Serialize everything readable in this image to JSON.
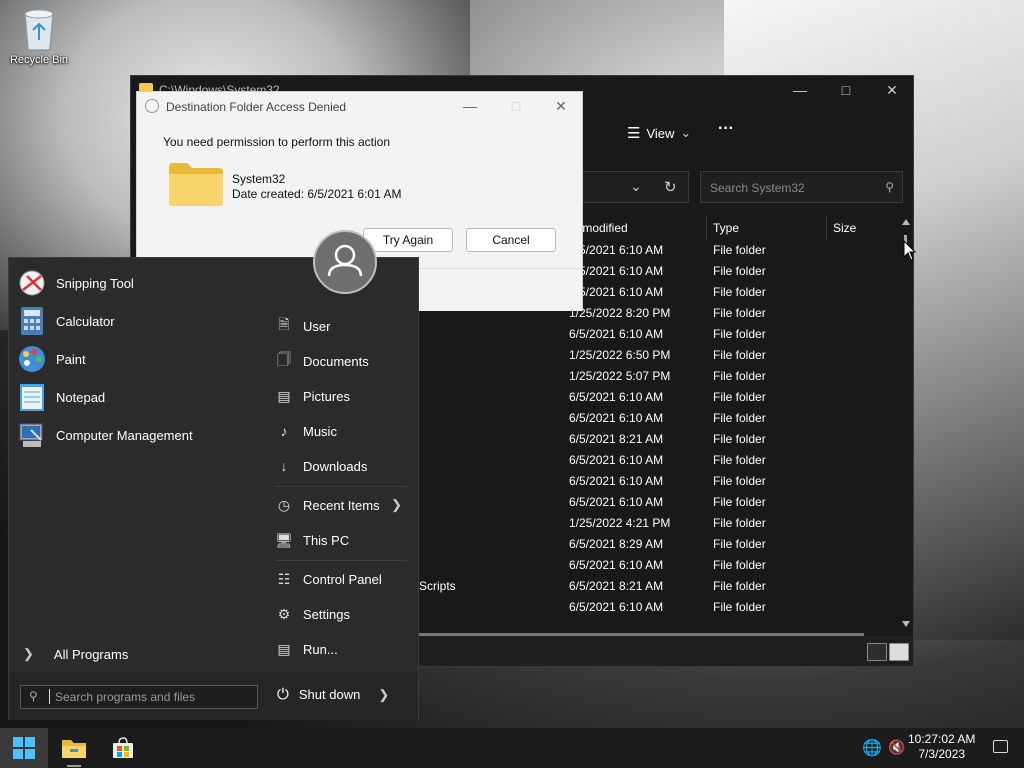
{
  "desktop": {
    "recycle_bin_label": "Recycle Bin"
  },
  "explorer": {
    "title_path": "C:\\Windows\\System32",
    "toolbar": {
      "view_label": "View",
      "more_label": "···"
    },
    "search_placeholder": "Search System32",
    "columns": {
      "modified": "te modified",
      "type": "Type",
      "size": "Size"
    },
    "rows": [
      {
        "name": "",
        "modified": "6/5/2021 6:10 AM",
        "type": "File folder"
      },
      {
        "name": "",
        "modified": "6/5/2021 6:10 AM",
        "type": "File folder"
      },
      {
        "name": "",
        "modified": "6/5/2021 6:10 AM",
        "type": "File folder"
      },
      {
        "name": "",
        "modified": "1/25/2022 8:20 PM",
        "type": "File folder"
      },
      {
        "name": "",
        "modified": "6/5/2021 6:10 AM",
        "type": "File folder"
      },
      {
        "name": "",
        "modified": "1/25/2022 6:50 PM",
        "type": "File folder"
      },
      {
        "name": "",
        "modified": "1/25/2022 5:07 PM",
        "type": "File folder"
      },
      {
        "name": "",
        "modified": "6/5/2021 6:10 AM",
        "type": "File folder"
      },
      {
        "name": "",
        "modified": "6/5/2021 6:10 AM",
        "type": "File folder"
      },
      {
        "name": "",
        "modified": "6/5/2021 8:21 AM",
        "type": "File folder"
      },
      {
        "name": "",
        "modified": "6/5/2021 6:10 AM",
        "type": "File folder"
      },
      {
        "name": "",
        "modified": "6/5/2021 6:10 AM",
        "type": "File folder"
      },
      {
        "name": "",
        "modified": "6/5/2021 6:10 AM",
        "type": "File folder"
      },
      {
        "name": "",
        "modified": "1/25/2022 4:21 PM",
        "type": "File folder"
      },
      {
        "name": "",
        "modified": "6/5/2021 8:29 AM",
        "type": "File folder"
      },
      {
        "name": "",
        "modified": "6/5/2021 6:10 AM",
        "type": "File folder"
      },
      {
        "name": "Scripts",
        "modified": "6/5/2021 8:21 AM",
        "type": "File folder"
      },
      {
        "name": "",
        "modified": "6/5/2021 6:10 AM",
        "type": "File folder"
      }
    ]
  },
  "dialog": {
    "title": "Destination Folder Access Denied",
    "message": "You need permission to perform this action",
    "folder_name": "System32",
    "date_created": "Date created: 6/5/2021 6:01 AM",
    "try_again": "Try Again",
    "cancel": "Cancel"
  },
  "start_menu": {
    "pinned": [
      {
        "label": "Snipping Tool",
        "icon": "snipping-tool-icon"
      },
      {
        "label": "Calculator",
        "icon": "calculator-icon"
      },
      {
        "label": "Paint",
        "icon": "paint-icon"
      },
      {
        "label": "Notepad",
        "icon": "notepad-icon"
      },
      {
        "label": "Computer Management",
        "icon": "computer-management-icon"
      }
    ],
    "places": [
      {
        "label": "User",
        "icon": "user-folder-icon"
      },
      {
        "label": "Documents",
        "icon": "documents-icon"
      },
      {
        "label": "Pictures",
        "icon": "pictures-icon"
      },
      {
        "label": "Music",
        "icon": "music-icon"
      },
      {
        "label": "Downloads",
        "icon": "downloads-icon"
      },
      {
        "label": "Recent Items",
        "icon": "recent-icon"
      },
      {
        "label": "This PC",
        "icon": "this-pc-icon"
      },
      {
        "label": "Control Panel",
        "icon": "control-panel-icon"
      },
      {
        "label": "Settings",
        "icon": "settings-icon"
      },
      {
        "label": "Run...",
        "icon": "run-icon"
      }
    ],
    "all_programs": "All Programs",
    "search_placeholder": "Search programs and files",
    "shutdown": "Shut down"
  },
  "taskbar": {
    "time": "10:27:02 AM",
    "date": "7/3/2023"
  },
  "colors": {
    "accent": "#0078d4",
    "folder": "#f2c94c"
  }
}
